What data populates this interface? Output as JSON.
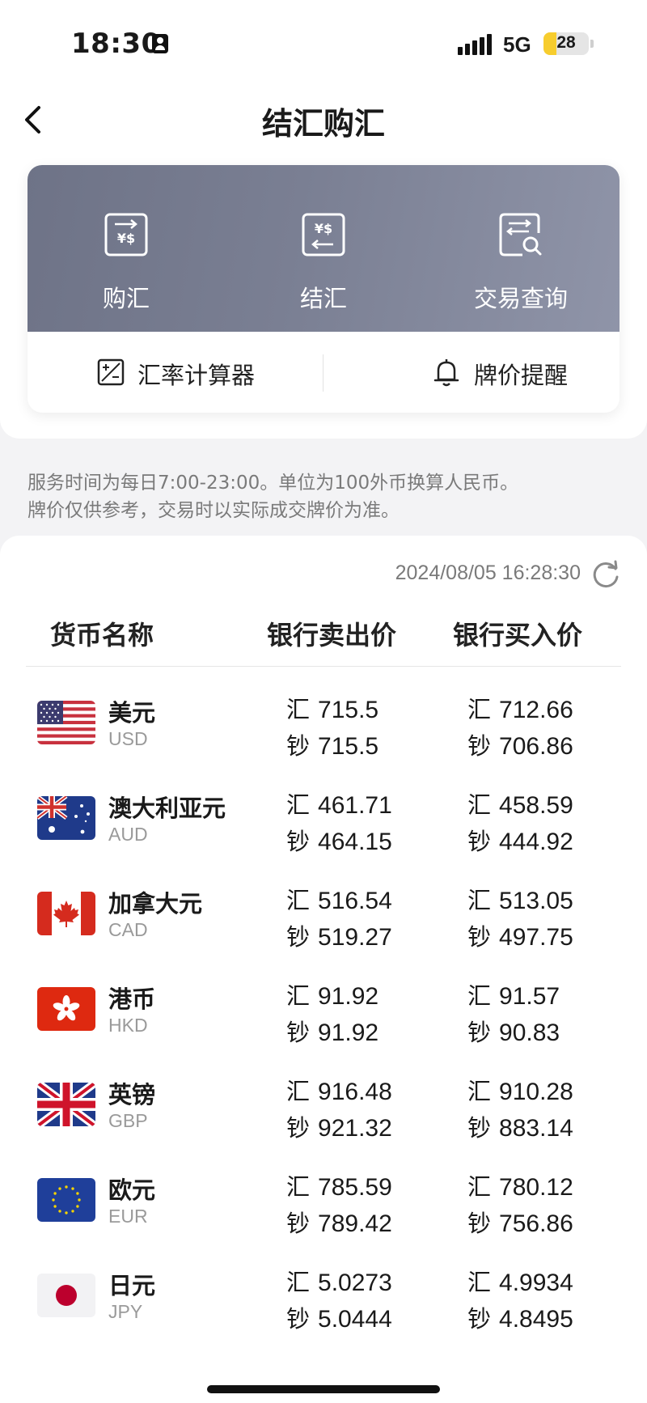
{
  "status_bar": {
    "time": "18:30",
    "network": "5G",
    "battery": "28",
    "battery_level": 0.28
  },
  "header": {
    "title": "结汇购汇"
  },
  "actions": [
    {
      "label": "购汇",
      "icon": "buy-exchange-icon"
    },
    {
      "label": "结汇",
      "icon": "settle-exchange-icon"
    },
    {
      "label": "交易查询",
      "icon": "transaction-query-icon"
    }
  ],
  "tools": [
    {
      "label": "汇率计算器",
      "icon": "calculator-icon"
    },
    {
      "label": "牌价提醒",
      "icon": "bell-icon"
    }
  ],
  "notice": {
    "line1": "服务时间为每日7:00-23:00。单位为100外币换算人民币。",
    "line2": "牌价仅供参考，交易时以实际成交牌价为准。"
  },
  "rates": {
    "updated_at": "2024/08/05 16:28:30",
    "columns": {
      "name": "货币名称",
      "sell": "银行卖出价",
      "buy": "银行买入价"
    },
    "prefix_remit": "汇",
    "prefix_cash": "钞",
    "currencies": [
      {
        "name": "美元",
        "code": "USD",
        "flag": "us-flag",
        "sell_remit": "715.5",
        "sell_cash": "715.5",
        "buy_remit": "712.66",
        "buy_cash": "706.86"
      },
      {
        "name": "澳大利亚元",
        "code": "AUD",
        "flag": "au-flag",
        "sell_remit": "461.71",
        "sell_cash": "464.15",
        "buy_remit": "458.59",
        "buy_cash": "444.92"
      },
      {
        "name": "加拿大元",
        "code": "CAD",
        "flag": "ca-flag",
        "sell_remit": "516.54",
        "sell_cash": "519.27",
        "buy_remit": "513.05",
        "buy_cash": "497.75"
      },
      {
        "name": "港币",
        "code": "HKD",
        "flag": "hk-flag",
        "sell_remit": "91.92",
        "sell_cash": "91.92",
        "buy_remit": "91.57",
        "buy_cash": "90.83"
      },
      {
        "name": "英镑",
        "code": "GBP",
        "flag": "gb-flag",
        "sell_remit": "916.48",
        "sell_cash": "921.32",
        "buy_remit": "910.28",
        "buy_cash": "883.14"
      },
      {
        "name": "欧元",
        "code": "EUR",
        "flag": "eu-flag",
        "sell_remit": "785.59",
        "sell_cash": "789.42",
        "buy_remit": "780.12",
        "buy_cash": "756.86"
      },
      {
        "name": "日元",
        "code": "JPY",
        "flag": "jp-flag",
        "sell_remit": "5.0273",
        "sell_cash": "5.0444",
        "buy_remit": "4.9934",
        "buy_cash": "4.8495"
      }
    ]
  },
  "colors": {
    "banner_start": "#6e7387",
    "banner_end": "#8f94a8",
    "battery_fill": "#f7cd2e",
    "muted_text": "#7a7a7a"
  }
}
